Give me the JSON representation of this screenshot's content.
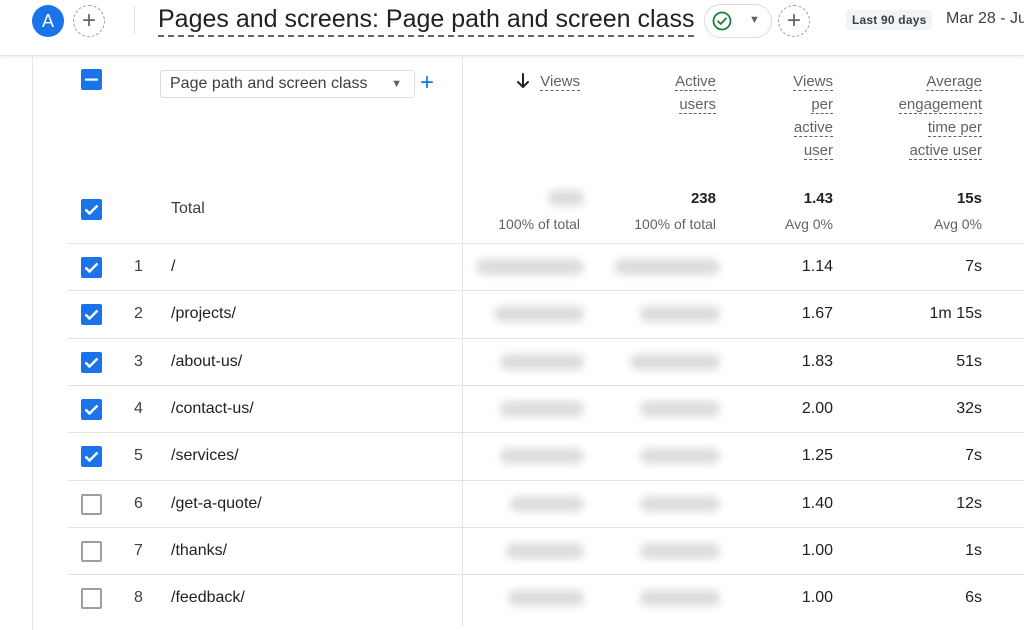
{
  "header": {
    "avatar_letter": "A",
    "add_comparison": "+",
    "title": "Pages and screens: Page path and screen class",
    "add_button": "+",
    "date_label": "Last 90 days",
    "date_range": "Mar 28 - Ju"
  },
  "table": {
    "dimension_selector": "Page path and screen class",
    "add_dimension": "+",
    "columns": {
      "views": "Views",
      "active_users": [
        "Active",
        "users"
      ],
      "views_per_user": [
        "Views",
        "per",
        "active",
        "user"
      ],
      "avg_engagement": [
        "Average",
        "engagement",
        "time per",
        "active user"
      ]
    },
    "total": {
      "label": "Total",
      "views_sub": "100% of total",
      "active_users": "238",
      "active_users_sub": "100% of total",
      "views_per_user": "1.43",
      "views_per_user_sub": "Avg 0%",
      "avg_engagement": "15s",
      "avg_engagement_sub": "Avg 0%"
    },
    "rows": [
      {
        "num": "1",
        "path": "/",
        "vpu": "1.14",
        "eng": "7s",
        "checked": true
      },
      {
        "num": "2",
        "path": "/projects/",
        "vpu": "1.67",
        "eng": "1m 15s",
        "checked": true
      },
      {
        "num": "3",
        "path": "/about-us/",
        "vpu": "1.83",
        "eng": "51s",
        "checked": true
      },
      {
        "num": "4",
        "path": "/contact-us/",
        "vpu": "2.00",
        "eng": "32s",
        "checked": true
      },
      {
        "num": "5",
        "path": "/services/",
        "vpu": "1.25",
        "eng": "7s",
        "checked": true
      },
      {
        "num": "6",
        "path": "/get-a-quote/",
        "vpu": "1.40",
        "eng": "12s",
        "checked": false
      },
      {
        "num": "7",
        "path": "/thanks/",
        "vpu": "1.00",
        "eng": "1s",
        "checked": false
      },
      {
        "num": "8",
        "path": "/feedback/",
        "vpu": "1.00",
        "eng": "6s",
        "checked": false
      }
    ]
  },
  "colors": {
    "accent": "#1a73e8",
    "success": "#188038"
  },
  "icons": [
    "plus-icon",
    "check-circle-icon",
    "caret-down-icon",
    "arrow-down-icon",
    "checkbox-icon"
  ]
}
